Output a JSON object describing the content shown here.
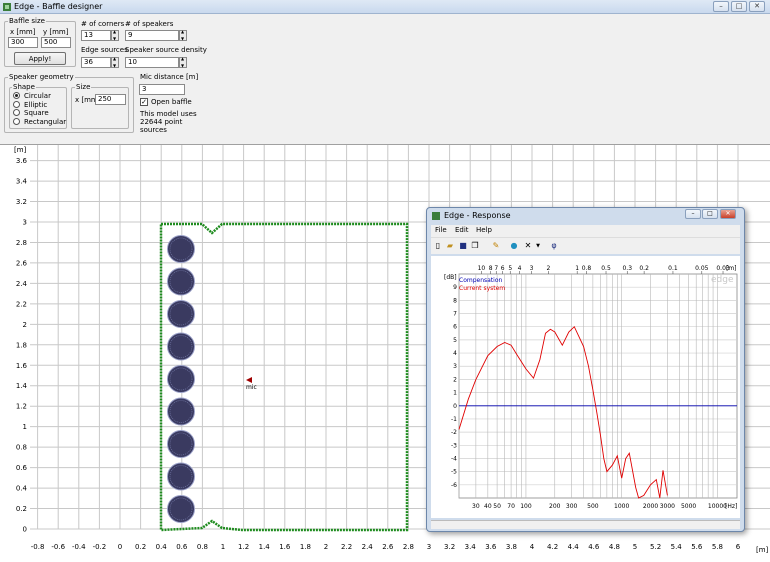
{
  "window": {
    "title": "Edge - Baffle designer"
  },
  "controls": {
    "baffle_size": {
      "label": "Baffle size",
      "x_label": "x [mm]",
      "y_label": "y [mm]",
      "x_value": "300",
      "y_value": "500",
      "apply": "Apply!"
    },
    "corners": {
      "label": "# of corners",
      "value": "13"
    },
    "speakers": {
      "label": "# of speakers",
      "value": "9"
    },
    "edge_sources": {
      "label": "Edge sources",
      "value": "36"
    },
    "density": {
      "label": "Speaker source density",
      "value": "10"
    },
    "geometry": {
      "label": "Speaker geometry",
      "shape_label": "Shape",
      "shapes": [
        "Circular",
        "Elliptic",
        "Square",
        "Rectangular"
      ],
      "selected": "Circular",
      "size_label": "Size",
      "size_x_label": "x [mm]",
      "size_value": "250"
    },
    "mic": {
      "label": "Mic distance [m]",
      "value": "3",
      "open_baffle": "Open baffle",
      "open_baffle_checked": true,
      "info": [
        "This model uses",
        "22644 point",
        "sources"
      ]
    }
  },
  "plot": {
    "y_unit": "[m]",
    "x_unit": "[m]",
    "y_ticks": [
      "0",
      "0.2",
      "0.4",
      "0.6",
      "0.8",
      "1",
      "1.2",
      "1.4",
      "1.6",
      "1.8",
      "2",
      "2.2",
      "2.4",
      "2.6",
      "2.8",
      "3",
      "3.2",
      "3.4",
      "3.6"
    ],
    "x_ticks": [
      "-0.8",
      "-0.6",
      "-0.4",
      "-0.2",
      "0",
      "0.2",
      "0.4",
      "0.6",
      "0.8",
      "1",
      "1.2",
      "1.4",
      "1.6",
      "1.8",
      "2",
      "2.2",
      "2.4",
      "2.6",
      "2.8",
      "3",
      "3.2",
      "3.4",
      "3.6",
      "3.8",
      "4",
      "4.2",
      "4.4",
      "4.6",
      "4.8",
      "5",
      "5.2",
      "5.4",
      "5.6",
      "5.8",
      "6"
    ],
    "mic_label": "mic",
    "speaker_count": 9,
    "colors": {
      "baffle": "#1f8c1f",
      "speaker": "#3a3a60",
      "grid": "#c8c8c8",
      "mic": "#a00000"
    }
  },
  "response": {
    "title": "Edge - Response",
    "menu": [
      "File",
      "Edit",
      "Help"
    ],
    "toolbar_icons": [
      "new-icon",
      "open-icon",
      "save-icon",
      "copy-icon",
      "pencil-icon",
      "globe-icon",
      "close-x-icon",
      "dropdown-icon",
      "phi-icon"
    ],
    "watermark": "edge",
    "db_unit": "[dB]",
    "hz_unit": "[Hz]",
    "m_unit": "[m]",
    "legend": [
      {
        "name": "Compensation",
        "color": "#0000b0"
      },
      {
        "name": "Current system",
        "color": "#e00000"
      }
    ],
    "y_ticks": [
      "9",
      "8",
      "7",
      "6",
      "5",
      "4",
      "3",
      "2",
      "1",
      "0",
      "-1",
      "-2",
      "-3",
      "-4",
      "-5",
      "-6"
    ],
    "hz_ticks": [
      "30",
      "40",
      "50",
      "70",
      "100",
      "200",
      "300",
      "500",
      "1000",
      "2000",
      "3000",
      "5000",
      "10000"
    ],
    "m_ticks": [
      "10",
      "8",
      "7",
      "6",
      "5",
      "4",
      "3",
      "2",
      "1",
      "0.8",
      "0.5",
      "0.3",
      "0.2",
      "0.1",
      "0.05",
      "0.03"
    ]
  },
  "chart_data": {
    "type": "line",
    "xlabel": "[Hz]",
    "ylabel": "[dB]",
    "x_scale": "log",
    "xlim": [
      20,
      16000
    ],
    "ylim": [
      -7,
      10
    ],
    "series": [
      {
        "name": "Compensation",
        "x": [
          20,
          16000
        ],
        "y": [
          0,
          0
        ]
      },
      {
        "name": "Current system",
        "x": [
          20,
          25,
          30,
          40,
          50,
          60,
          70,
          80,
          100,
          120,
          140,
          160,
          180,
          200,
          240,
          280,
          320,
          360,
          400,
          450,
          500,
          550,
          600,
          650,
          700,
          800,
          900,
          1000,
          1100,
          1200,
          1400,
          1500,
          1700,
          2000,
          2300,
          2500,
          2700,
          3000
        ],
        "y": [
          -1.8,
          0.5,
          2.0,
          3.8,
          4.5,
          4.8,
          4.6,
          3.9,
          2.8,
          2.1,
          3.5,
          5.5,
          5.8,
          5.6,
          4.6,
          5.6,
          6.0,
          5.2,
          4.5,
          3.0,
          1.2,
          -0.5,
          -2.2,
          -4.0,
          -5.0,
          -4.5,
          -3.8,
          -5.5,
          -4.0,
          -3.6,
          -6.2,
          -7.2,
          -6.8,
          -6.0,
          -5.6,
          -7.0,
          -4.9,
          -6.8
        ]
      }
    ]
  }
}
